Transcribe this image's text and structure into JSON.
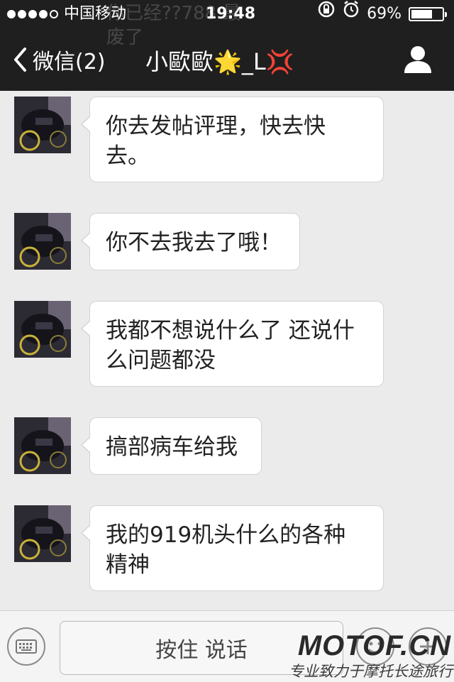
{
  "status": {
    "carrier": "中国移动",
    "time": "19:48",
    "battery": "69%",
    "battery_level": 0.69,
    "ghost_line1": "你已经??788   最",
    "ghost_line2": "废了"
  },
  "nav": {
    "back_label": "微信(2)",
    "title": "小歐歐🌟_L💢"
  },
  "messages": [
    {
      "text": "你去发帖评理，快去快去。"
    },
    {
      "text": "你不去我去了哦！"
    },
    {
      "text": "我都不想说什么了  还说什么问题都没"
    },
    {
      "text": "搞部病车给我"
    },
    {
      "text": "我的919机头什么的各种精神"
    }
  ],
  "input": {
    "voice_label": "按住 说话"
  },
  "watermark": {
    "logo": "MOTOF.CN",
    "slogan": "专业致力于摩托长途旅行"
  },
  "colors": {
    "header_bg": "#1f1f1f",
    "chat_bg": "#ebebeb",
    "bubble_bg": "#ffffff"
  }
}
